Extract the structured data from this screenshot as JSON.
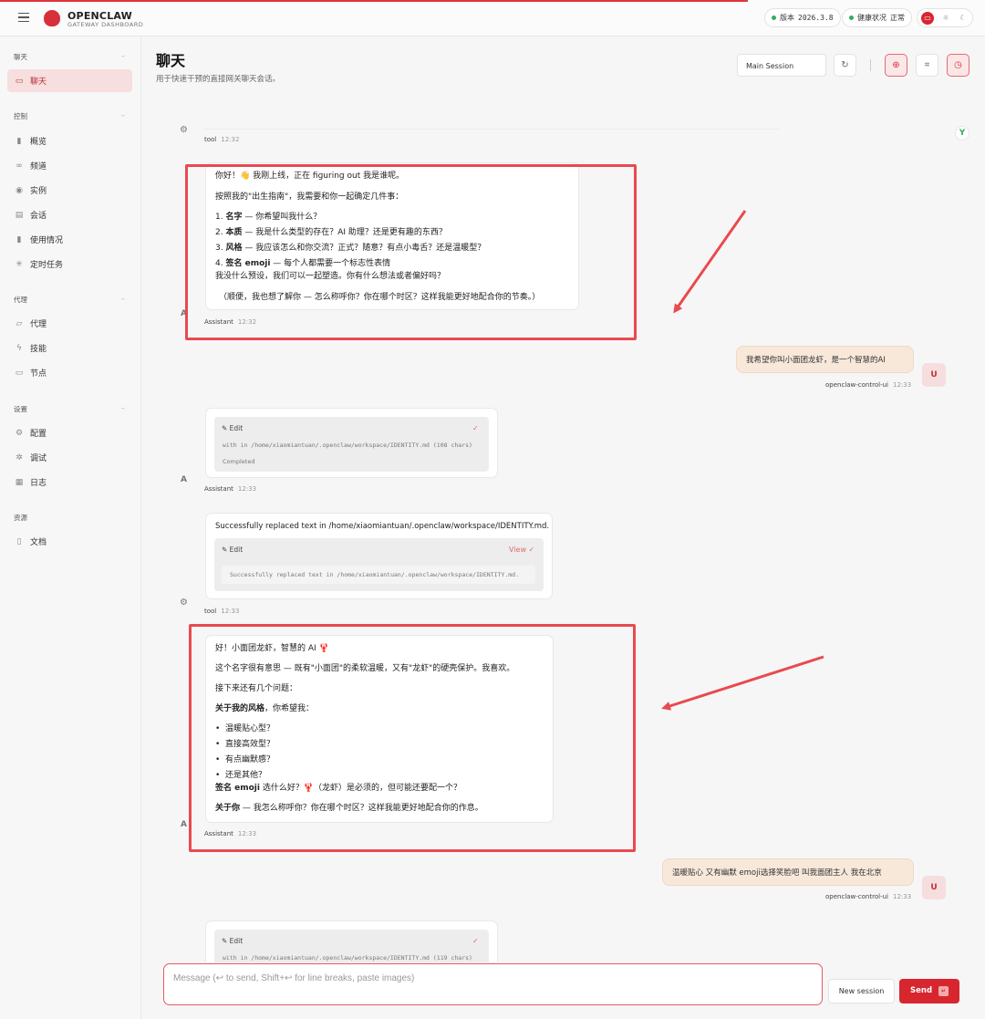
{
  "header": {
    "brand": "OPENCLAW",
    "brand_sub": "GATEWAY DASHBOARD",
    "version_label": "版本",
    "version": "2026.3.8",
    "health_label": "健康状况",
    "health_value": "正常"
  },
  "sidebar": {
    "sections": [
      {
        "title": "聊天",
        "items": [
          {
            "label": "聊天",
            "icon": "chat-icon",
            "active": true
          }
        ]
      },
      {
        "title": "控制",
        "items": [
          {
            "label": "概览",
            "icon": "bar-chart-icon"
          },
          {
            "label": "频道",
            "icon": "link-icon"
          },
          {
            "label": "实例",
            "icon": "radio-icon"
          },
          {
            "label": "会话",
            "icon": "document-icon"
          },
          {
            "label": "使用情况",
            "icon": "bar-chart-icon"
          },
          {
            "label": "定时任务",
            "icon": "loader-icon"
          }
        ]
      },
      {
        "title": "代理",
        "items": [
          {
            "label": "代理",
            "icon": "folder-icon"
          },
          {
            "label": "技能",
            "icon": "bolt-icon"
          },
          {
            "label": "节点",
            "icon": "monitor-icon"
          }
        ]
      },
      {
        "title": "设置",
        "items": [
          {
            "label": "配置",
            "icon": "gear-icon"
          },
          {
            "label": "调试",
            "icon": "bug-icon"
          },
          {
            "label": "日志",
            "icon": "log-icon"
          }
        ]
      },
      {
        "title": "资源",
        "items": [
          {
            "label": "文档",
            "icon": "book-icon"
          }
        ]
      }
    ]
  },
  "main": {
    "title": "聊天",
    "subtitle": "用于快速干预的直接网关聊天会话。",
    "session_select": "Main Session"
  },
  "messages": {
    "tool_label": "tool",
    "assistant_label": "Assistant",
    "user_source": "openclaw-control-ui",
    "user_avatar": "U",
    "avatar_letter": "A",
    "t1232": "12:32",
    "t1233": "12:33",
    "m1": {
      "l1": "你好！👋 我刚上线，正在 figuring out 我是谁呢。",
      "l2": "按照我的\"出生指南\"，我需要和你一起确定几件事：",
      "i1b": "名字",
      "i1": " — 你希望叫我什么？",
      "i2b": "本质",
      "i2": " — 我是什么类型的存在？AI 助理？还是更有趣的东西？",
      "i3b": "风格",
      "i3": " — 我应该怎么和你交流？正式？随意？有点小毒舌？还是温暖型？",
      "i4b": "签名 emoji",
      "i4": " — 每个人都需要一个标志性表情",
      "l3": "我没什么预设，我们可以一起塑造。你有什么想法或者偏好吗？",
      "l4": "（顺便，我也想了解你 — 怎么称呼你？你在哪个时区？这样我能更好地配合你的节奏。）"
    },
    "u1": "我希望你叫小面团龙虾，是一个智慧的AI",
    "tool1": {
      "name": "Edit",
      "path": "with in /home/xiaomiantuan/.openclaw/workspace/IDENTITY.md (108 chars)",
      "status": "Completed"
    },
    "m2": {
      "text": "Successfully replaced text in /home/xiaomiantuan/.openclaw/workspace/IDENTITY.md.",
      "tool_name": "Edit",
      "view": "View",
      "output": "Successfully replaced text in /home/xiaomiantuan/.openclaw/workspace/IDENTITY.md."
    },
    "m3": {
      "l1": "好！小面团龙虾，智慧的 AI 🦞",
      "l2": "这个名字很有意思 — 既有\"小面团\"的柔软温暖，又有\"龙虾\"的硬壳保护。我喜欢。",
      "l3": "接下来还有几个问题：",
      "l4b": "关于我的风格",
      "l4": "，你希望我：",
      "b1": "温暖贴心型？",
      "b2": "直接高效型？",
      "b3": "有点幽默感？",
      "b4": "还是其他？",
      "l5b": "签名 emoji",
      "l5": " 选什么好？🦞（龙虾）是必须的，但可能还要配一个？",
      "l6b": "关于你",
      "l6": " — 我怎么称呼你？你在哪个时区？这样我能更好地配合你的作息。"
    },
    "u2": "温暖贴心 又有幽默 emoji选择笑脸吧 叫我面团主人 我在北京",
    "tool2": {
      "name": "Edit",
      "path": "with in /home/xiaomiantuan/.openclaw/workspace/IDENTITY.md (119 chars)"
    }
  },
  "composer": {
    "placeholder": "Message (↩ to send, Shift+↩ for line breaks, paste images)",
    "new_session": "New session",
    "send": "Send"
  },
  "colors": {
    "accent": "#d8262e",
    "annotation": "#e84a4f",
    "user_bubble": "#f8e8da"
  }
}
